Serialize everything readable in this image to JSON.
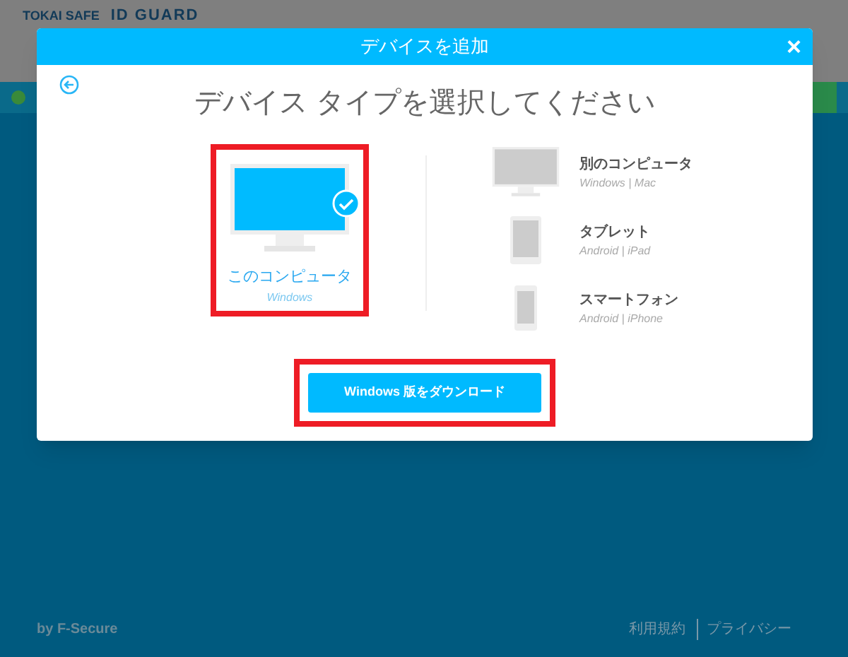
{
  "background": {
    "brand_left": "TOKAI SAFE",
    "brand_right": "ID GUARD",
    "footer": {
      "vendor": "by F-Secure",
      "links": [
        "利用規約",
        "プライバシー"
      ]
    }
  },
  "dialog": {
    "title": "デバイスを追加",
    "close": "×",
    "heading": "デバイス タイプを選択してください",
    "devices": [
      {
        "kind": "desktop",
        "name": "このコンピュータ",
        "platforms": "Windows",
        "selected": true,
        "highlighted": true
      },
      {
        "kind": "desktop",
        "name": "別のコンピュータ",
        "platforms": "Windows | Mac",
        "selected": false,
        "highlighted": false
      },
      {
        "kind": "tablet",
        "name": "タブレット",
        "platforms": "Android | iPad",
        "selected": false,
        "highlighted": false
      },
      {
        "kind": "phone",
        "name": "スマートフォン",
        "platforms": "Android | iPhone",
        "selected": false,
        "highlighted": false
      }
    ],
    "download_button": {
      "label": "Windows 版をダウンロード",
      "highlighted": true
    }
  }
}
